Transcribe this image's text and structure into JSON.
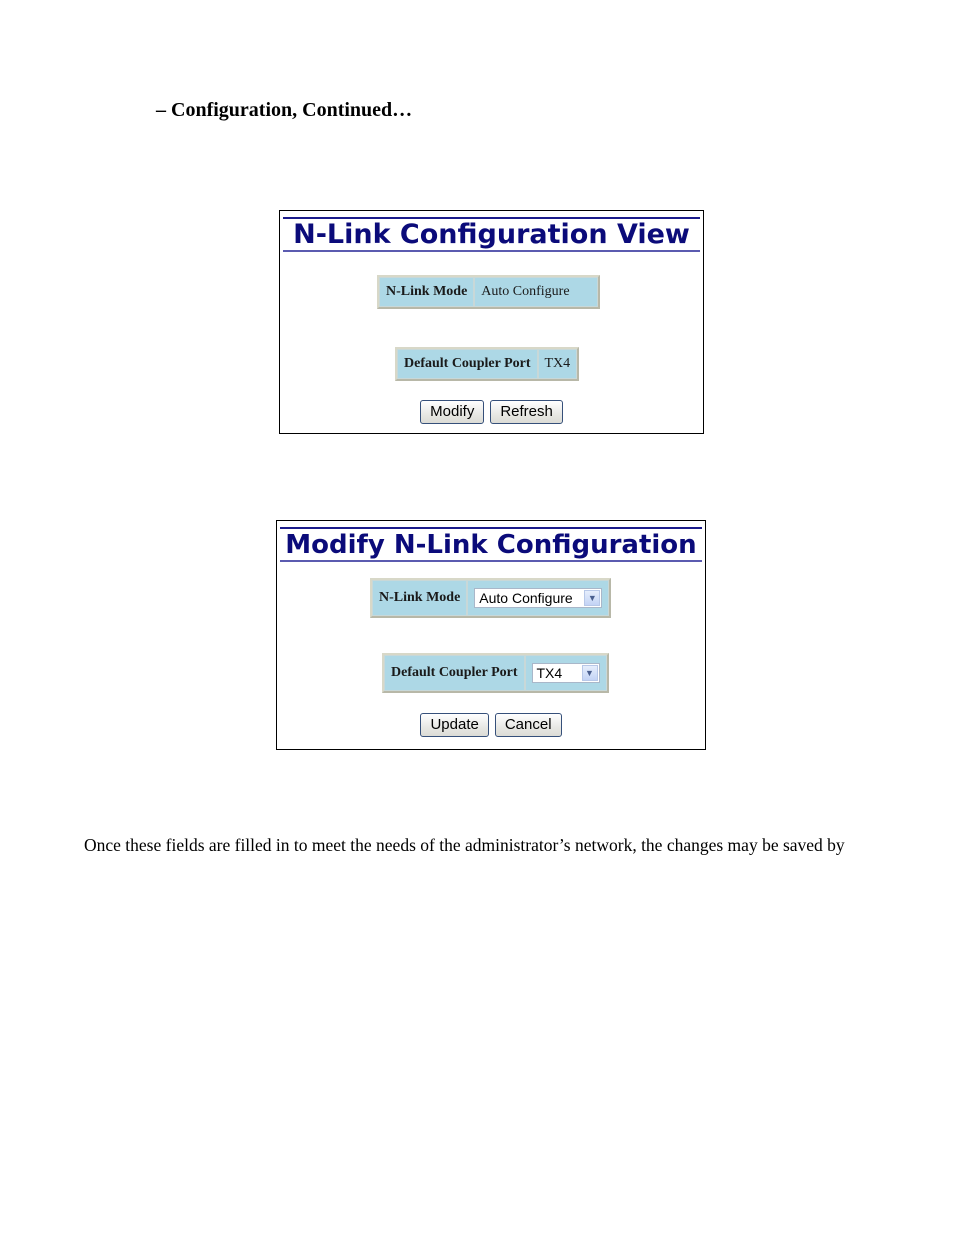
{
  "document": {
    "section_heading": "– Configuration, Continued…",
    "body_text": "Once these fields are filled in to meet the needs of the administrator’s network, the changes may be saved by"
  },
  "view_panel": {
    "title": "N-Link Configuration View",
    "nlink_mode": {
      "label": "N-Link Mode",
      "value": "Auto Configure"
    },
    "coupler_port": {
      "label": "Default Coupler Port",
      "value": "TX4"
    },
    "buttons": {
      "modify": "Modify",
      "refresh": "Refresh"
    }
  },
  "modify_panel": {
    "title": "Modify N-Link Configuration",
    "nlink_mode": {
      "label": "N-Link Mode",
      "selected": "Auto Configure"
    },
    "coupler_port": {
      "label": "Default Coupler Port",
      "selected": "TX4"
    },
    "buttons": {
      "update": "Update",
      "cancel": "Cancel"
    }
  },
  "icons": {
    "dropdown": "chevron-down-icon"
  },
  "colors": {
    "title_color": "#0b0b7a",
    "table_bg": "#add8e6"
  }
}
